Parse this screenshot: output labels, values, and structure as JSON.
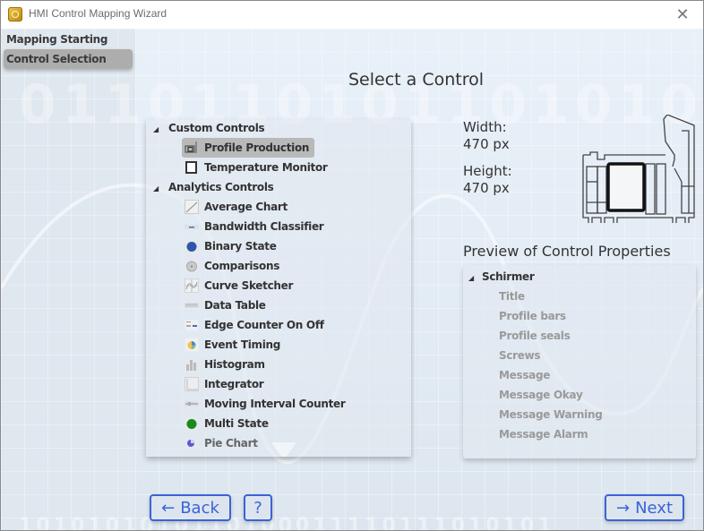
{
  "window": {
    "title": "HMI Control Mapping Wizard",
    "close_icon": "close-icon"
  },
  "sidebar": {
    "items": [
      {
        "label": "Mapping Starting Point",
        "active": false
      },
      {
        "label": "Control Selection",
        "active": true
      }
    ]
  },
  "main": {
    "title": "Select a Control",
    "tree": {
      "groups": [
        {
          "label": "Custom Controls",
          "expanded": true,
          "items": [
            {
              "label": "Profile Production",
              "icon": "profile-production-icon",
              "selected": true
            },
            {
              "label": "Temperature Monitor",
              "icon": "temperature-monitor-icon",
              "selected": false
            }
          ]
        },
        {
          "label": "Analytics Controls",
          "expanded": true,
          "items": [
            {
              "label": "Average Chart",
              "icon": "average-chart-icon"
            },
            {
              "label": "Bandwidth Classifier",
              "icon": "bandwidth-classifier-icon"
            },
            {
              "label": "Binary State",
              "icon": "binary-state-icon"
            },
            {
              "label": "Comparisons",
              "icon": "comparisons-icon"
            },
            {
              "label": "Curve Sketcher",
              "icon": "curve-sketcher-icon"
            },
            {
              "label": "Data Table",
              "icon": "data-table-icon"
            },
            {
              "label": "Edge Counter On Off",
              "icon": "edge-counter-icon"
            },
            {
              "label": "Event Timing",
              "icon": "event-timing-icon"
            },
            {
              "label": "Histogram",
              "icon": "histogram-icon"
            },
            {
              "label": "Integrator",
              "icon": "integrator-icon"
            },
            {
              "label": "Moving Interval Counter",
              "icon": "moving-interval-counter-icon"
            },
            {
              "label": "Multi State",
              "icon": "multi-state-icon"
            },
            {
              "label": "Pie Chart",
              "icon": "pie-chart-icon"
            }
          ]
        }
      ]
    },
    "dimensions": {
      "width_label": "Width:",
      "width_value": "470 px",
      "height_label": "Height:",
      "height_value": "470 px"
    },
    "preview": {
      "title": "Preview of Control Properties",
      "root": "Schirmer",
      "properties": [
        "Title",
        "Profile bars",
        "Profile seals",
        "Screws",
        "Message",
        "Message Okay",
        "Message Warning",
        "Message Alarm"
      ]
    }
  },
  "footer": {
    "back_label": "Back",
    "back_arrow": "←",
    "help_label": "?",
    "next_label": "Next",
    "next_arrow": "→"
  },
  "colors": {
    "button_accent": "#3a63d8",
    "selected_bg": "#b9b9b9"
  }
}
